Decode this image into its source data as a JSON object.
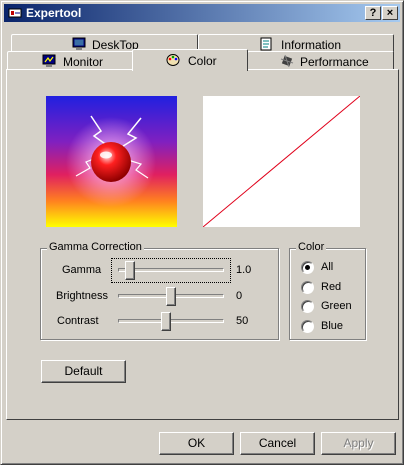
{
  "window": {
    "title": "Expertool",
    "help_glyph": "?",
    "close_glyph": "×"
  },
  "tabs": {
    "row1": [
      {
        "label": "DeskTop",
        "icon": "desktop-monitor-icon"
      },
      {
        "label": "Information",
        "icon": "information-document-icon"
      }
    ],
    "row2": [
      {
        "label": "Monitor",
        "icon": "monitor-icon"
      },
      {
        "label": "Color",
        "icon": "color-palette-icon",
        "selected": true
      },
      {
        "label": "Performance",
        "icon": "performance-chip-icon"
      }
    ]
  },
  "gamma_group": {
    "title": "Gamma Correction",
    "sliders": [
      {
        "label": "Gamma",
        "value": "1.0",
        "level": 0.12,
        "focused": true
      },
      {
        "label": "Brightness",
        "value": "0",
        "level": 0.5
      },
      {
        "label": "Contrast",
        "value": "50",
        "level": 0.45
      }
    ]
  },
  "color_group": {
    "title": "Color",
    "options": [
      "All",
      "Red",
      "Green",
      "Blue"
    ],
    "selected": "All"
  },
  "buttons": {
    "default": "Default",
    "ok": "OK",
    "cancel": "Cancel",
    "apply": "Apply"
  },
  "colors": {
    "titlebar_start": "#0a246a",
    "titlebar_end": "#a6caf0",
    "gamma_curve": "#e0001a",
    "face": "#d4d0c8"
  }
}
